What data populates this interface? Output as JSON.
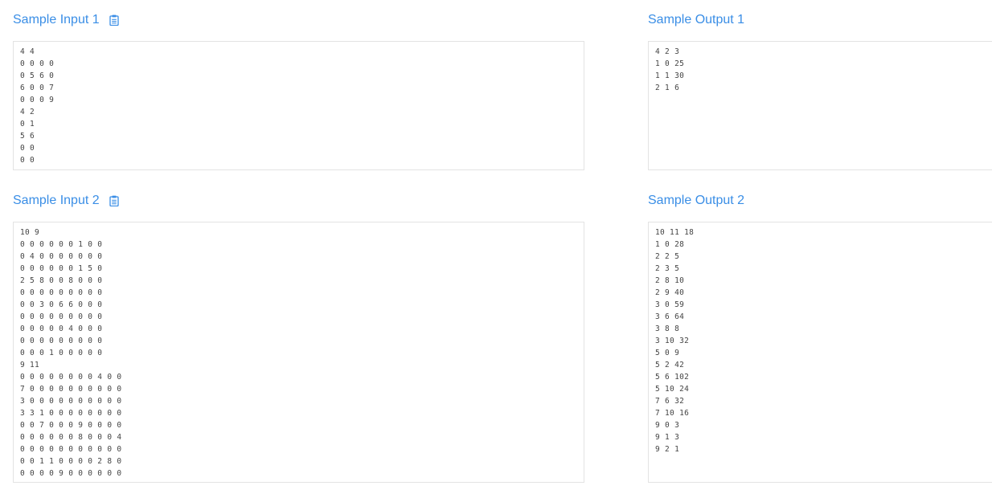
{
  "sample_input_1": {
    "title": "Sample Input 1",
    "content": "4 4\n0 0 0 0\n0 5 6 0\n6 0 0 7\n0 0 0 9\n4 2\n0 1\n5 6\n0 0\n0 0"
  },
  "sample_output_1": {
    "title": "Sample Output 1",
    "content": "4 2 3\n1 0 25\n1 1 30\n2 1 6"
  },
  "sample_input_2": {
    "title": "Sample Input 2",
    "content": "10 9\n0 0 0 0 0 0 1 0 0\n0 4 0 0 0 0 0 0 0\n0 0 0 0 0 0 1 5 0\n2 5 8 0 0 8 0 0 0\n0 0 0 0 0 0 0 0 0\n0 0 3 0 6 6 0 0 0\n0 0 0 0 0 0 0 0 0\n0 0 0 0 0 4 0 0 0\n0 0 0 0 0 0 0 0 0\n0 0 0 1 0 0 0 0 0\n9 11\n0 0 0 0 0 0 0 0 4 0 0\n7 0 0 0 0 0 0 0 0 0 0\n3 0 0 0 0 0 0 0 0 0 0\n3 3 1 0 0 0 0 0 0 0 0\n0 0 7 0 0 0 9 0 0 0 0\n0 0 0 0 0 0 8 0 0 0 4\n0 0 0 0 0 0 0 0 0 0 0\n0 0 1 1 0 0 0 0 2 8 0\n0 0 0 0 9 0 0 0 0 0 0"
  },
  "sample_output_2": {
    "title": "Sample Output 2",
    "content": "10 11 18\n1 0 28\n2 2 5\n2 3 5\n2 8 10\n2 9 40\n3 0 59\n3 6 64\n3 8 8\n3 10 32\n5 0 9\n5 2 42\n5 6 102\n5 10 24\n7 6 32\n7 10 16\n9 0 3\n9 1 3\n9 2 1"
  },
  "icons": {
    "copy": "clipboard-icon"
  },
  "colors": {
    "title": "#3a8ee6",
    "border": "#e3e3e3",
    "text": "#444444"
  }
}
